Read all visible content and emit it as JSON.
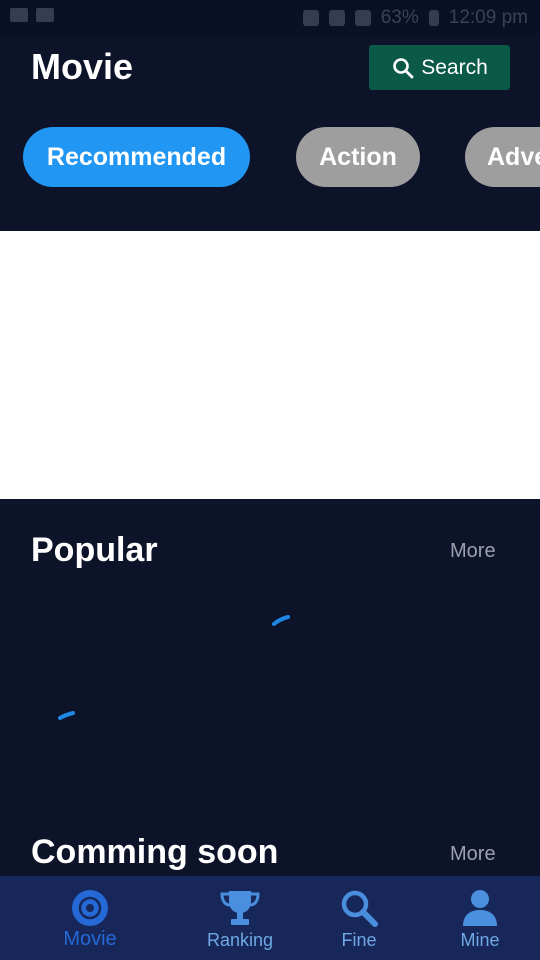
{
  "status_bar": {
    "battery": "63%",
    "time": "12:09 pm"
  },
  "header": {
    "title": "Movie",
    "search_label": "Search"
  },
  "categories": [
    {
      "label": "Recommended",
      "active": true
    },
    {
      "label": "Action",
      "active": false
    },
    {
      "label": "Adve",
      "active": false
    }
  ],
  "sections": {
    "popular": {
      "title": "Popular",
      "more": "More"
    },
    "coming": {
      "title": "Comming soon",
      "more": "More"
    }
  },
  "bottom_nav": [
    {
      "label": "Movie",
      "icon": "disc-icon",
      "active": true
    },
    {
      "label": "Ranking",
      "icon": "trophy-icon",
      "active": false
    },
    {
      "label": "Fine",
      "icon": "search-icon",
      "active": false
    },
    {
      "label": "Mine",
      "icon": "person-icon",
      "active": false
    }
  ],
  "colors": {
    "background": "#0d1329",
    "accent": "#2196f3",
    "search_button": "#0a5a47",
    "chip_inactive": "#9e9e9e",
    "nav_background": "#17275a",
    "nav_active": "#2469d6",
    "nav_inactive": "#6fa8e4"
  }
}
